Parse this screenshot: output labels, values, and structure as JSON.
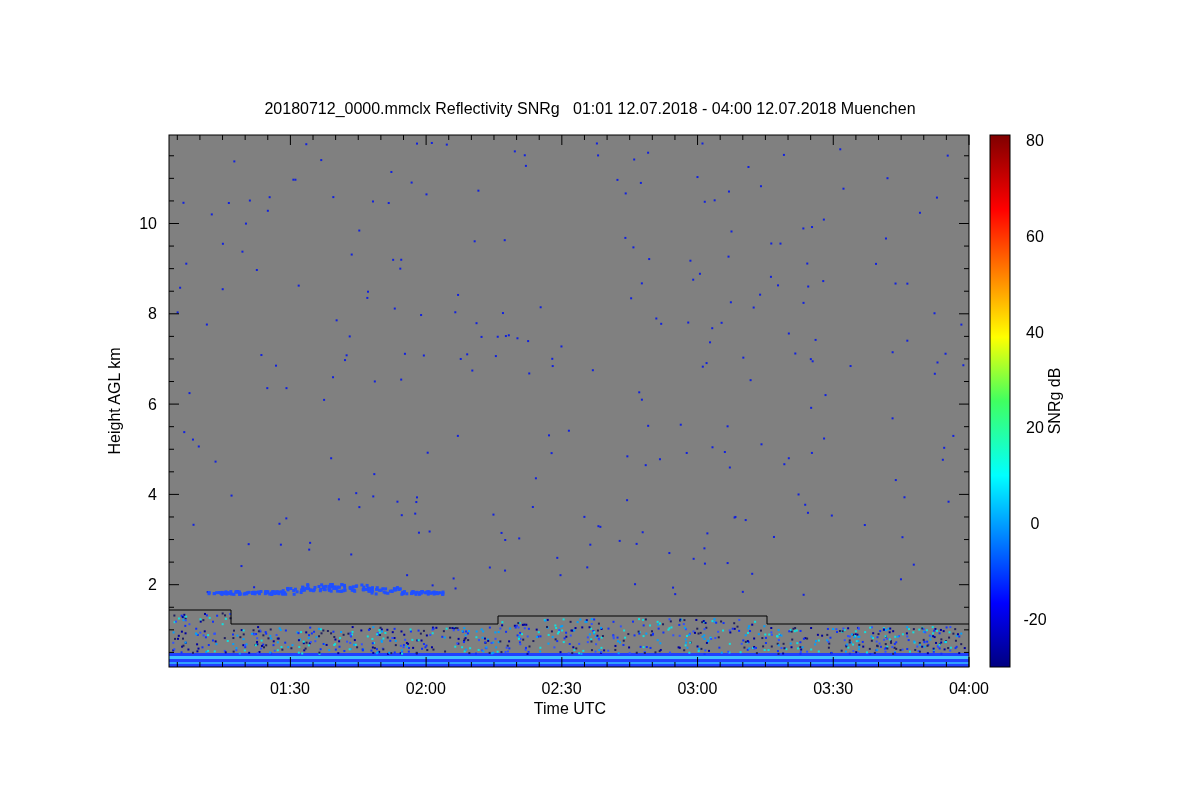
{
  "title": "20180712_0000.mmclx Reflectivity SNRg   01:01 12.07.2018 - 04:00 12.07.2018 Muenchen",
  "plot": {
    "ylabel": "Height AGL km",
    "xlabel": "Time UTC",
    "yticks": [
      "10",
      "8",
      "6",
      "4",
      "2"
    ],
    "xticks": [
      "01:30",
      "02:00",
      "02:30",
      "03:00",
      "03:30",
      "04:00"
    ]
  },
  "colorbar": {
    "label": "SNRg dB",
    "ticks": [
      "80",
      "60",
      "40",
      "20",
      "0",
      "-20"
    ]
  }
}
